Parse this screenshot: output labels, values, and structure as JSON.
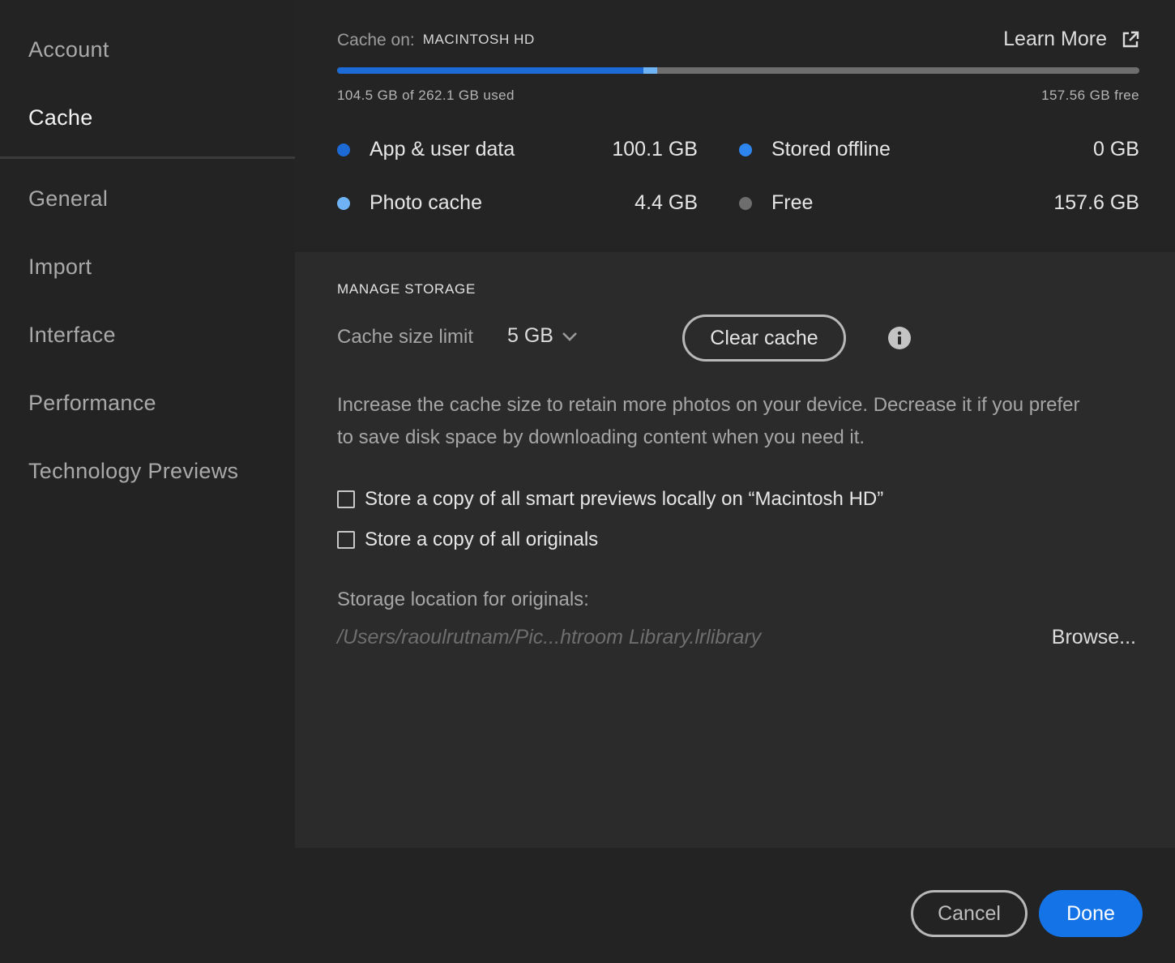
{
  "sidebar": {
    "items": [
      {
        "label": "Account",
        "active": false
      },
      {
        "label": "Cache",
        "active": true
      },
      {
        "label": "General",
        "active": false
      },
      {
        "label": "Import",
        "active": false
      },
      {
        "label": "Interface",
        "active": false
      },
      {
        "label": "Performance",
        "active": false
      },
      {
        "label": "Technology Previews",
        "active": false
      }
    ]
  },
  "storage": {
    "cache_on_label": "Cache on:",
    "drive_name": "MACINTOSH HD",
    "learn_more": "Learn More",
    "learn_more_icon": "external-link-icon",
    "used_text": "104.5 GB of 262.1 GB used",
    "free_text": "157.56 GB free",
    "usage_bar": {
      "app_user_data_fraction": 0.382,
      "photo_cache_fraction": 0.017,
      "colors": {
        "app_user_data": "#1c6ad6",
        "photo_cache": "#6fb3f5",
        "free": "#6e6e6e"
      }
    },
    "legend": [
      {
        "label": "App & user data",
        "value": "100.1 GB",
        "color": "#1c6ad6"
      },
      {
        "label": "Stored offline",
        "value": "0 GB",
        "color": "#2d86ef"
      },
      {
        "label": "Photo cache",
        "value": "4.4 GB",
        "color": "#6fb3f5"
      },
      {
        "label": "Free",
        "value": "157.6 GB",
        "color": "#6e6e6e"
      }
    ]
  },
  "manage": {
    "title": "MANAGE STORAGE",
    "limit_label": "Cache size limit",
    "limit_value": "5 GB",
    "clear_button": "Clear cache",
    "info_icon": "info-icon",
    "description": "Increase the cache size to retain more photos on your device. Decrease it if you prefer to save disk space by downloading content when you need it.",
    "checkboxes": [
      {
        "label": "Store a copy of all smart previews locally on “Macintosh HD”",
        "checked": false
      },
      {
        "label": "Store a copy of all originals",
        "checked": false
      }
    ],
    "location_label": "Storage location for originals:",
    "location_path": "/Users/raoulrutnam/Pic...htroom Library.lrlibrary",
    "browse": "Browse..."
  },
  "footer": {
    "cancel": "Cancel",
    "done": "Done",
    "accent_color": "#1473e6"
  }
}
